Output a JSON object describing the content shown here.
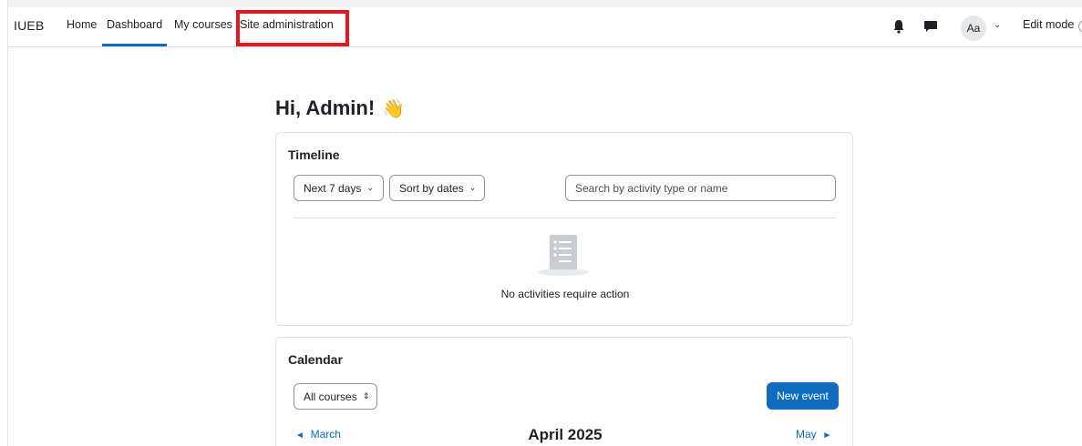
{
  "navbar": {
    "brand": "IUEB",
    "links": [
      "Home",
      "Dashboard",
      "My courses",
      "Site administration"
    ],
    "active_link": "Dashboard",
    "highlighted_link": "Site administration",
    "avatar_initials": "Aa",
    "edit_mode_label": "Edit mode",
    "icons": [
      "bell-icon",
      "chat-icon",
      "chevron-down-icon"
    ]
  },
  "main": {
    "greeting": "Hi, Admin!",
    "greeting_emoji": "👋"
  },
  "timeline": {
    "title": "Timeline",
    "filter_label": "Next 7 days",
    "sort_label": "Sort by dates",
    "search_placeholder": "Search by activity type or name",
    "empty_message": "No activities require action"
  },
  "calendar": {
    "title": "Calendar",
    "course_filter": "All courses",
    "new_event_label": "New event",
    "prev_month": "March",
    "current_month": "April 2025",
    "next_month": "May"
  },
  "colors": {
    "primary": "#0f6cbf",
    "highlight_border": "#e8161b",
    "text": "#1d2125",
    "border": "#dee2e6"
  }
}
